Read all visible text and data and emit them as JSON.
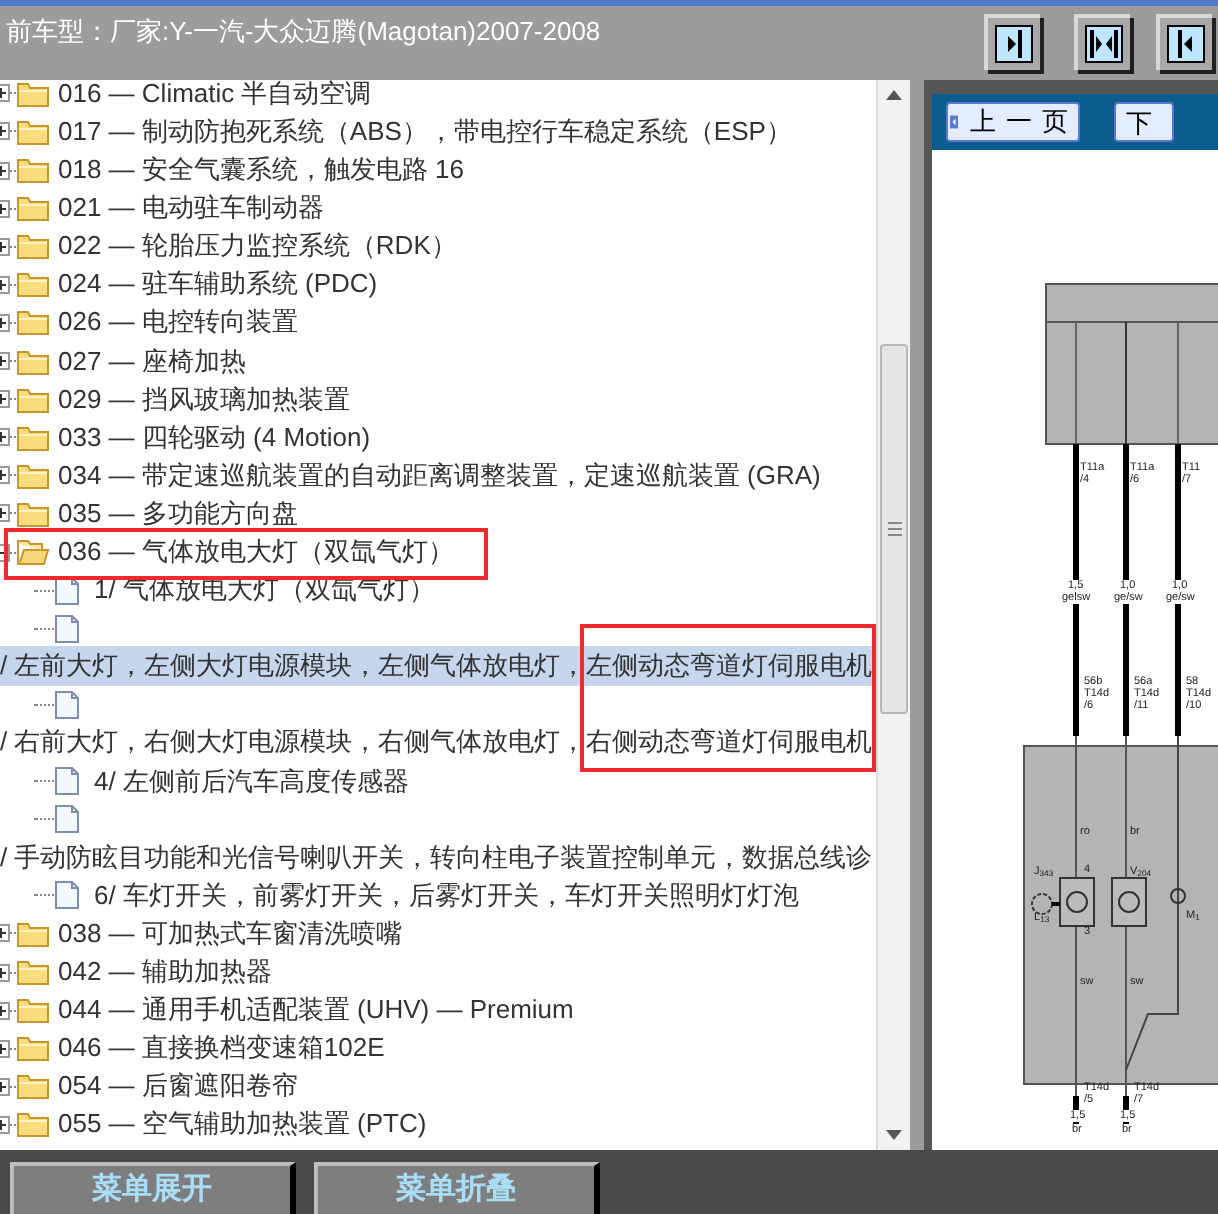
{
  "header": {
    "title": "前车型：厂家:Y-一汽-大众迈腾(Magotan)2007-2008",
    "buttons": [
      {
        "kind": "dock-right"
      },
      {
        "kind": "split"
      },
      {
        "kind": "dock-left"
      }
    ]
  },
  "tree": {
    "items": [
      {
        "label": "016 — Climatic 半自动空调",
        "expanded": false
      },
      {
        "label": "017 — 制动防抱死系统（ABS），带电控行车稳定系统（ESP）",
        "expanded": false
      },
      {
        "label": "018 — 安全气囊系统，触发电路 16",
        "expanded": false
      },
      {
        "label": "021 — 电动驻车制动器",
        "expanded": false
      },
      {
        "label": "022 — 轮胎压力监控系统（RDK）",
        "expanded": false
      },
      {
        "label": "024 — 驻车辅助系统 (PDC)",
        "expanded": false
      },
      {
        "label": "026 — 电控转向装置",
        "expanded": false
      },
      {
        "label": "027 — 座椅加热",
        "expanded": false
      },
      {
        "label": "029 — 挡风玻璃加热装置",
        "expanded": false
      },
      {
        "label": "033 — 四轮驱动 (4 Motion)",
        "expanded": false
      },
      {
        "label": "034 — 带定速巡航装置的自动距离调整装置，定速巡航装置 (GRA)",
        "expanded": false
      },
      {
        "label": "035 — 多功能方向盘",
        "expanded": false
      },
      {
        "label": "036 — 气体放电大灯（双氙气灯）",
        "expanded": true,
        "children": [
          {
            "kind": "doc",
            "label": "1/ 气体放电大灯（双氙气灯）",
            "selected": false
          },
          {
            "kind": "wrapped",
            "label": "/ 左前大灯，左侧大灯电源模块，左侧气体放电灯，左侧动态弯道灯伺服电机",
            "selected": true
          },
          {
            "kind": "wrapped",
            "label": "/ 右前大灯，右侧大灯电源模块，右侧气体放电灯，右侧动态弯道灯伺服电机",
            "selected": false
          },
          {
            "kind": "doc",
            "label": "4/ 左侧前后汽车高度传感器",
            "selected": false
          },
          {
            "kind": "wrapped",
            "label": "/ 手动防眩目功能和光信号喇叭开关，转向柱电子装置控制单元，数据总线诊",
            "selected": false
          },
          {
            "kind": "doc",
            "label": "6/ 车灯开关，前雾灯开关，后雾灯开关，车灯开关照明灯灯泡",
            "selected": false
          }
        ]
      },
      {
        "label": "038 — 可加热式车窗清洗喷嘴",
        "expanded": false
      },
      {
        "label": "042 — 辅助加热器",
        "expanded": false
      },
      {
        "label": "044 — 通用手机适配装置 (UHV) — Premium",
        "expanded": false
      },
      {
        "label": "046 — 直接换档变速箱102E",
        "expanded": false
      },
      {
        "label": "054 — 后窗遮阳卷帘",
        "expanded": false
      },
      {
        "label": "055 — 空气辅助加热装置 (PTC)",
        "expanded": false
      }
    ],
    "row_frame": true,
    "tail_frame": true
  },
  "viewer": {
    "prev_button": "上一页",
    "next_button": "下",
    "diagram_labels": [
      "T11a",
      "/4",
      "T11a",
      "/6",
      "T11",
      "/7",
      "1,5",
      "gelsw",
      "1,0",
      "ge/sw",
      "1,0",
      "ge/sw",
      "56b",
      "T14d",
      "/6",
      "56a",
      "T14d",
      "/11",
      "58",
      "T14d",
      "/10",
      "ro",
      "br",
      "J$_{343}$",
      "4",
      "V$_{204}$",
      "L$_{13}$",
      "3",
      "M$_{1}$",
      "sw",
      "sw",
      "T14d",
      "/5",
      "1,5",
      "br",
      "T14d",
      "/7",
      "1,5",
      "br"
    ]
  },
  "bottom_buttons": [
    "菜单展开",
    "菜单折叠"
  ]
}
